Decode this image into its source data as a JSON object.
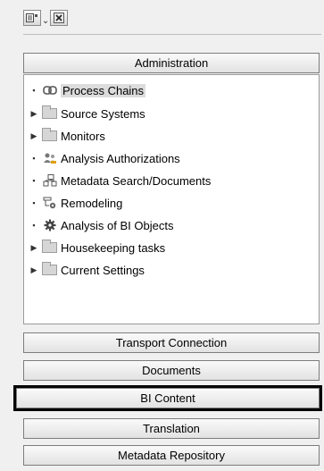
{
  "toolbar": {
    "buttons": [
      {
        "icon": "tree-settings-icon"
      },
      {
        "icon": "close-icon"
      }
    ]
  },
  "administration_label": "Administration",
  "tree_items": [
    {
      "label": "Process Chains",
      "icon": "chain-link-icon",
      "expandable": false,
      "selected": true
    },
    {
      "label": "Source Systems",
      "icon": "folder-icon",
      "expandable": true
    },
    {
      "label": "Monitors",
      "icon": "folder-icon",
      "expandable": true
    },
    {
      "label": "Analysis Authorizations",
      "icon": "users-key-icon",
      "expandable": false
    },
    {
      "label": "Metadata Search/Documents",
      "icon": "document-tree-icon",
      "expandable": false
    },
    {
      "label": "Remodeling",
      "icon": "remodel-icon",
      "expandable": false
    },
    {
      "label": "Analysis of BI Objects",
      "icon": "gear-icon",
      "expandable": false
    },
    {
      "label": "Housekeeping tasks",
      "icon": "folder-icon",
      "expandable": true
    },
    {
      "label": "Current Settings",
      "icon": "folder-icon",
      "expandable": true
    }
  ],
  "nav_buttons": {
    "transport": "Transport Connection",
    "documents": "Documents",
    "bi_content": "BI Content",
    "translation": "Translation",
    "metadata": "Metadata Repository"
  }
}
